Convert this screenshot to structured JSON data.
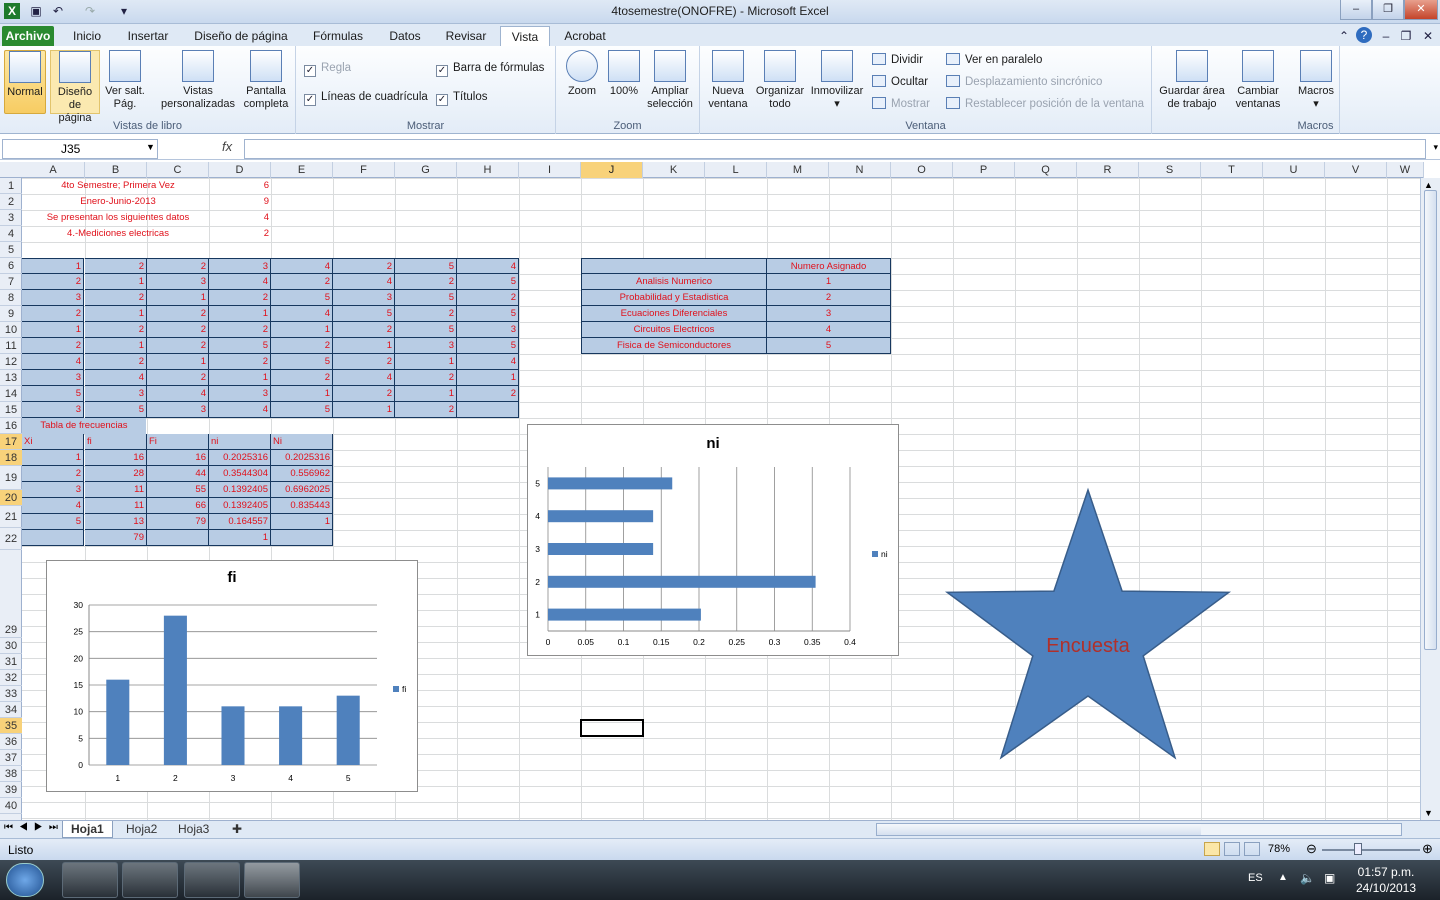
{
  "window": {
    "title": "4tosemestre(ONOFRE)  -  Microsoft Excel"
  },
  "ribbon_tabs": [
    "Archivo",
    "Inicio",
    "Insertar",
    "Diseño de página",
    "Fórmulas",
    "Datos",
    "Revisar",
    "Vista",
    "Acrobat"
  ],
  "ribbon": {
    "vistas": {
      "normal": "Normal",
      "diseno": "Diseño de página",
      "versalt": "Ver salt. Pág.",
      "personalizadas": "Vistas personalizadas",
      "pantalla": "Pantalla completa",
      "label": "Vistas de libro"
    },
    "mostrar": {
      "regla": "Regla",
      "barra": "Barra de fórmulas",
      "lineas": "Líneas de cuadrícula",
      "titulos": "Títulos",
      "label": "Mostrar"
    },
    "zoom": {
      "zoom": "Zoom",
      "z100": "100%",
      "ampliar": "Ampliar selección",
      "label": "Zoom"
    },
    "ventana": {
      "nueva": "Nueva ventana",
      "organizar": "Organizar todo",
      "inmovilizar": "Inmovilizar",
      "dividir": "Dividir",
      "ocultar": "Ocultar",
      "mostrar": "Mostrar",
      "paralelo": "Ver en paralelo",
      "desplazamiento": "Desplazamiento sincrónico",
      "restablecer": "Restablecer posición de la ventana",
      "guardar": "Guardar área de trabajo",
      "cambiar": "Cambiar ventanas",
      "label": "Ventana"
    },
    "macros": {
      "macros": "Macros",
      "label": "Macros"
    }
  },
  "formula_bar": {
    "name_box": "J35",
    "fx": "fx",
    "value": ""
  },
  "columns": [
    "A",
    "B",
    "C",
    "D",
    "E",
    "F",
    "G",
    "H",
    "I",
    "J",
    "K",
    "L",
    "M",
    "N",
    "O",
    "P",
    "Q",
    "R",
    "S",
    "T",
    "U",
    "V",
    "W"
  ],
  "rows": [
    "1",
    "2",
    "3",
    "4",
    "5",
    "6",
    "7",
    "8",
    "9",
    "10",
    "11",
    "12",
    "13",
    "14",
    "15",
    "16",
    "17",
    "18",
    "19",
    "20",
    "21",
    "22",
    "29",
    "30",
    "31",
    "32",
    "33",
    "34",
    "35",
    "36",
    "37",
    "38",
    "39",
    "40"
  ],
  "header_rows": [
    {
      "text": "4to Semestre; Primera Vez",
      "num": "6"
    },
    {
      "text": "Enero-Junio-2013",
      "num": "9"
    },
    {
      "text": "Se presentan los siguientes datos",
      "num": "4"
    },
    {
      "text": "4.-Mediciones electricas",
      "num": "2"
    }
  ],
  "data_table": [
    [
      "1",
      "2",
      "2",
      "3",
      "4",
      "2",
      "5",
      "4"
    ],
    [
      "2",
      "1",
      "3",
      "4",
      "2",
      "4",
      "2",
      "5"
    ],
    [
      "3",
      "2",
      "1",
      "2",
      "5",
      "3",
      "5",
      "2"
    ],
    [
      "2",
      "1",
      "2",
      "1",
      "4",
      "5",
      "2",
      "5"
    ],
    [
      "1",
      "2",
      "2",
      "2",
      "1",
      "2",
      "5",
      "3"
    ],
    [
      "2",
      "1",
      "2",
      "5",
      "2",
      "1",
      "3",
      "5"
    ],
    [
      "4",
      "2",
      "1",
      "2",
      "5",
      "2",
      "1",
      "4"
    ],
    [
      "3",
      "4",
      "2",
      "1",
      "2",
      "4",
      "2",
      "1"
    ],
    [
      "5",
      "3",
      "4",
      "3",
      "1",
      "2",
      "1",
      "2"
    ],
    [
      "3",
      "5",
      "3",
      "4",
      "5",
      "1",
      "2",
      ""
    ]
  ],
  "freq_table": {
    "title": "Tabla de frecuencias",
    "headers": [
      "Xi",
      "fi",
      "Fi",
      "ni",
      "Ni"
    ],
    "rows": [
      [
        "1",
        "16",
        "16",
        "0.2025316",
        "0.2025316"
      ],
      [
        "2",
        "28",
        "44",
        "0.3544304",
        "0.556962"
      ],
      [
        "3",
        "11",
        "55",
        "0.1392405",
        "0.6962025"
      ],
      [
        "4",
        "11",
        "66",
        "0.1392405",
        "0.835443"
      ],
      [
        "5",
        "13",
        "79",
        "0.164557",
        "1"
      ]
    ],
    "totals": [
      "",
      "79",
      "",
      "1",
      ""
    ]
  },
  "subjects_table": {
    "header": "Numero Asignado",
    "rows": [
      [
        "Analisis Numerico",
        "1"
      ],
      [
        "Probabilidad y Estadistica",
        "2"
      ],
      [
        "Ecuaciones Diferenciales",
        "3"
      ],
      [
        "Circuitos Electricos",
        "4"
      ],
      [
        "Fisica de Semiconductores",
        "5"
      ]
    ]
  },
  "shape": {
    "text": "Encuesta",
    "fill": "#4f81bd"
  },
  "chart_data": [
    {
      "type": "bar",
      "title": "fi",
      "categories": [
        "1",
        "2",
        "3",
        "4",
        "5"
      ],
      "series": [
        {
          "name": "fi",
          "values": [
            16,
            28,
            11,
            11,
            13
          ]
        }
      ],
      "ylim": [
        0,
        30
      ],
      "yticks": [
        "0",
        "5",
        "10",
        "15",
        "20",
        "25",
        "30"
      ],
      "legend": "right",
      "color": "#4f81bd"
    },
    {
      "type": "bar",
      "orientation": "horizontal",
      "title": "ni",
      "categories": [
        "1",
        "2",
        "3",
        "4",
        "5"
      ],
      "series": [
        {
          "name": "ni",
          "values": [
            0.2025316,
            0.3544304,
            0.1392405,
            0.1392405,
            0.164557
          ]
        }
      ],
      "xlim": [
        0,
        0.4
      ],
      "xticks": [
        "0",
        "0.05",
        "0.1",
        "0.15",
        "0.2",
        "0.25",
        "0.3",
        "0.35",
        "0.4"
      ],
      "legend": "right",
      "color": "#4f81bd"
    }
  ],
  "sheet_tabs": [
    "Hoja1",
    "Hoja2",
    "Hoja3"
  ],
  "status": {
    "ready": "Listo",
    "zoom": "78%"
  },
  "taskbar": {
    "lang": "ES",
    "time": "01:57 p.m.",
    "date": "24/10/2013"
  }
}
